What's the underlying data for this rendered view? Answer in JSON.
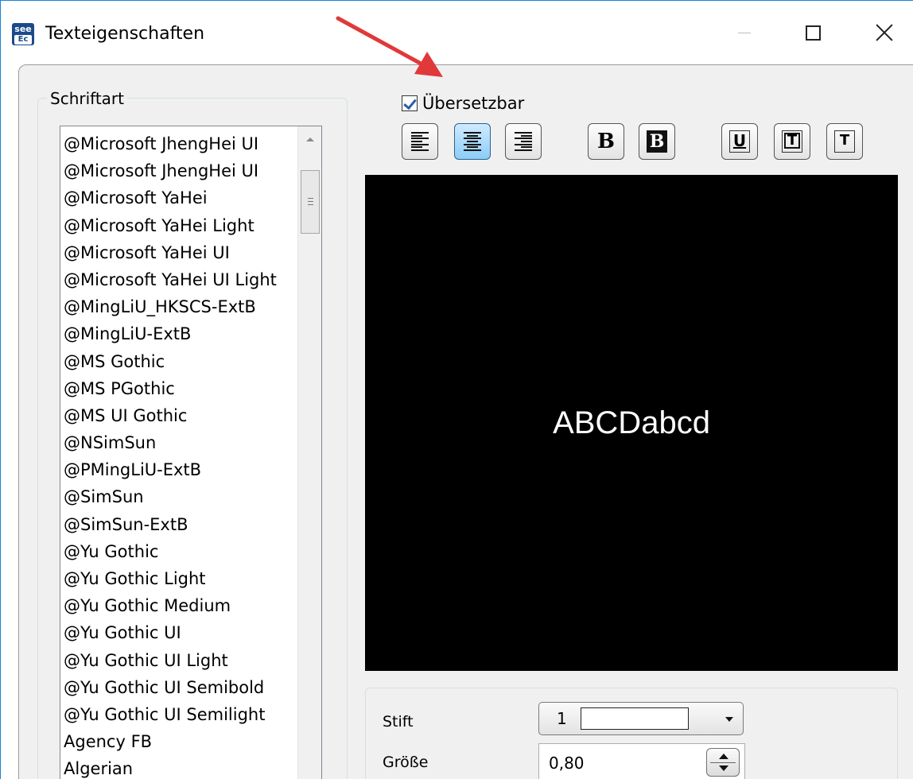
{
  "window": {
    "title": "Texteigenschaften",
    "icon_name": "seeEc-app-icon",
    "icon_top": "see",
    "icon_bottom": "Ec"
  },
  "titlebar_buttons": [
    "minimize-icon",
    "maximize-icon",
    "close-icon"
  ],
  "font_group": {
    "label": "Schriftart",
    "items": [
      "@Microsoft JhengHei UI",
      "@Microsoft JhengHei UI",
      "@Microsoft YaHei",
      "@Microsoft YaHei Light",
      "@Microsoft YaHei UI",
      "@Microsoft YaHei UI Light",
      "@MingLiU_HKSCS-ExtB",
      "@MingLiU-ExtB",
      "@MS Gothic",
      "@MS PGothic",
      "@MS UI Gothic",
      "@NSimSun",
      "@PMingLiU-ExtB",
      "@SimSun",
      "@SimSun-ExtB",
      "@Yu Gothic",
      "@Yu Gothic Light",
      "@Yu Gothic Medium",
      "@Yu Gothic UI",
      "@Yu Gothic UI Light",
      "@Yu Gothic UI Semibold",
      "@Yu Gothic UI Semilight",
      "Agency FB",
      "Algerian"
    ]
  },
  "translatable": {
    "label": "Übersetzbar",
    "checked": true
  },
  "toolbar": {
    "align_left": "align-left-icon",
    "align_center": "align-center-icon",
    "align_right": "align-right-icon",
    "bold_label": "B",
    "bold_box_label": "B",
    "underline_label": "U",
    "frame_label": "T",
    "shadow_label": "T",
    "active": "align-center"
  },
  "preview": {
    "text": "ABCDabcd",
    "background": "#000000",
    "text_color": "#ffffff"
  },
  "properties": {
    "pen_label": "Stift",
    "pen_value": "1",
    "pen_color": "#ffffff",
    "size_label": "Größe",
    "size_value": "0,80"
  },
  "colors": {
    "window_border": "#1883d7",
    "annotation_arrow": "#e0393a",
    "active_button": "#8ccdf7"
  }
}
